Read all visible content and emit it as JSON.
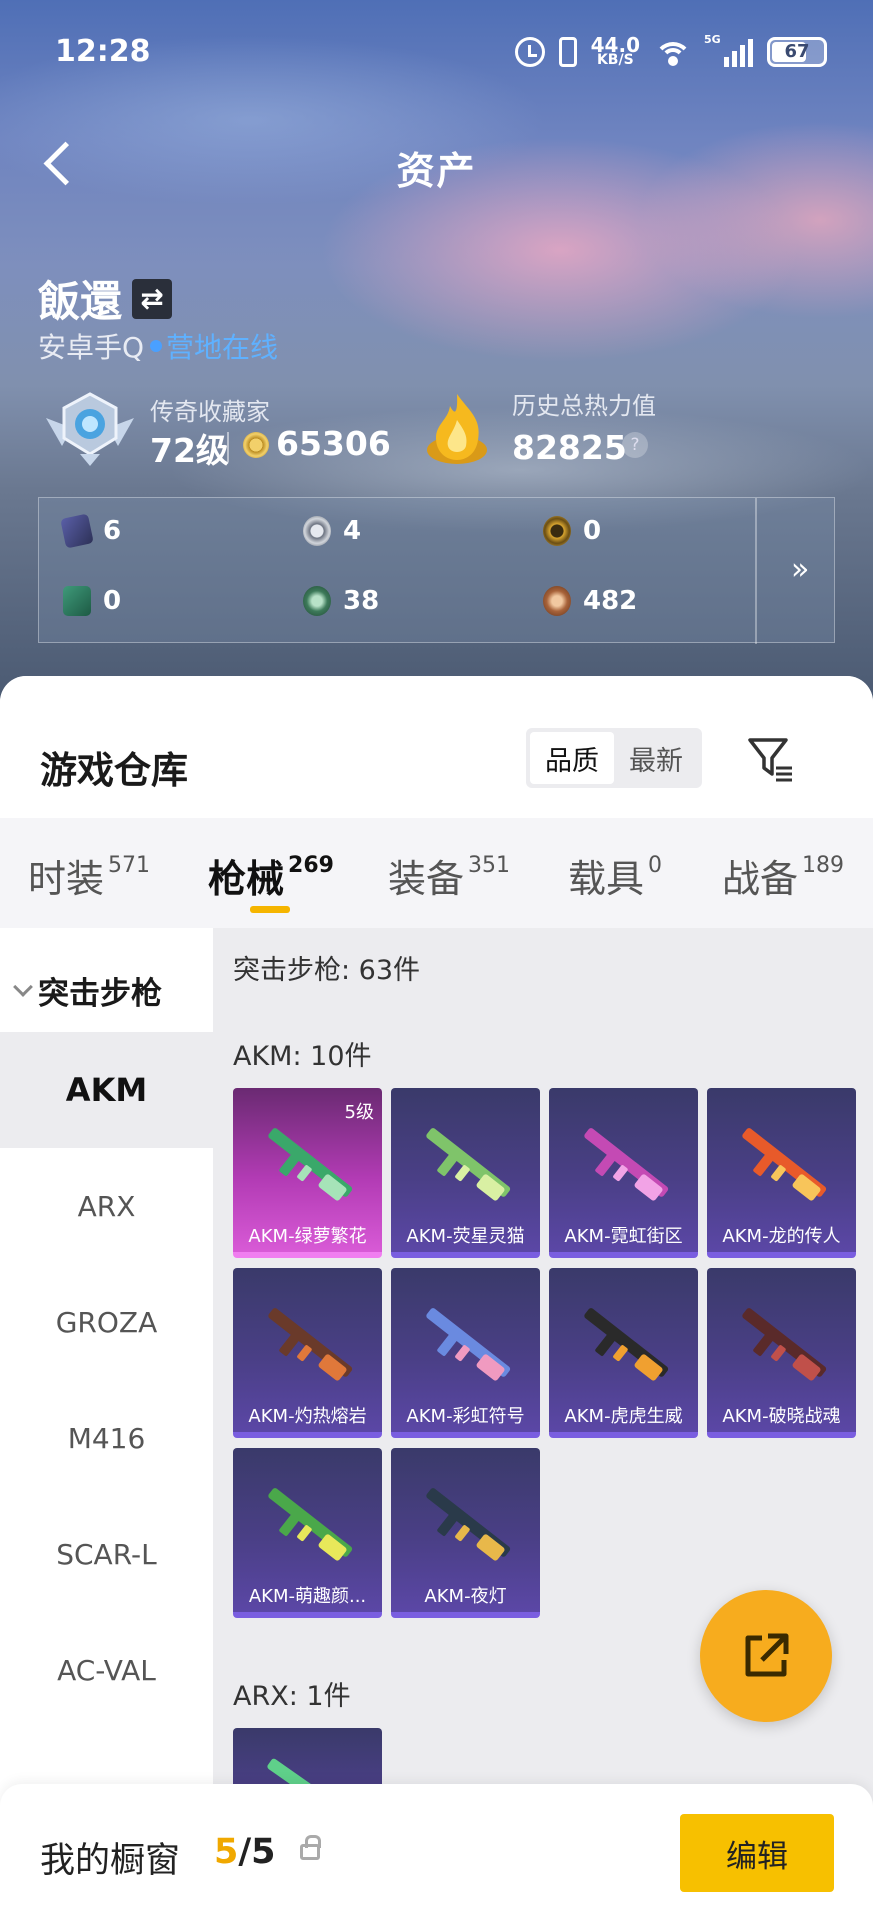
{
  "status_bar": {
    "time": "12:28",
    "net_speed_value": "44.0",
    "net_speed_unit": "KB/S",
    "network_type": "5G",
    "battery": "67"
  },
  "header": {
    "title": "资产"
  },
  "profile": {
    "name": "飯還",
    "platform": "安卓手Q",
    "presence": "营地在线",
    "rank_title": "传奇收藏家",
    "level": "72级",
    "coins": "65306",
    "heat_label": "历史总热力值",
    "heat_value": "82825",
    "help": "?"
  },
  "counts": [
    {
      "icon": "purple-card-icon",
      "value": "6"
    },
    {
      "icon": "silver-medal-icon",
      "value": "4"
    },
    {
      "icon": "gold-medal-icon",
      "value": "0"
    },
    {
      "icon": "green-card-icon",
      "value": "0"
    },
    {
      "icon": "green-coin-icon",
      "value": "38"
    },
    {
      "icon": "bronze-coin-icon",
      "value": "482"
    }
  ],
  "warehouse": {
    "title": "游戏仓库",
    "sort_options": [
      "品质",
      "最新"
    ],
    "tabs": [
      {
        "label": "时装",
        "count": "571"
      },
      {
        "label": "枪械",
        "count": "269"
      },
      {
        "label": "装备",
        "count": "351"
      },
      {
        "label": "载具",
        "count": "0"
      },
      {
        "label": "战备",
        "count": "189"
      }
    ],
    "category": "突击步枪",
    "sidebar_items": [
      "AKM",
      "ARX",
      "GROZA",
      "M416",
      "SCAR-L",
      "AC-VAL"
    ],
    "section_total": "突击步枪: 63件",
    "groups": [
      {
        "title": "AKM: 10件",
        "items": [
          {
            "name": "AKM-绿萝繁花",
            "level": "5级",
            "quality": "pink"
          },
          {
            "name": "AKM-荧星灵猫",
            "level": "",
            "quality": "purple"
          },
          {
            "name": "AKM-霓虹街区",
            "level": "",
            "quality": "purple"
          },
          {
            "name": "AKM-龙的传人",
            "level": "",
            "quality": "purple"
          },
          {
            "name": "AKM-灼热熔岩",
            "level": "",
            "quality": "purple"
          },
          {
            "name": "AKM-彩虹符号",
            "level": "",
            "quality": "purple"
          },
          {
            "name": "AKM-虎虎生威",
            "level": "",
            "quality": "purple"
          },
          {
            "name": "AKM-破晓战魂",
            "level": "",
            "quality": "purple"
          },
          {
            "name": "AKM-萌趣颜...",
            "level": "",
            "quality": "purple"
          },
          {
            "name": "AKM-夜灯",
            "level": "",
            "quality": "purple"
          }
        ]
      },
      {
        "title": "ARX: 1件",
        "items": []
      }
    ]
  },
  "bottom_bar": {
    "label": "我的橱窗",
    "current": "5",
    "separator": "/",
    "total": "5",
    "edit": "编辑"
  },
  "colors": {
    "accent": "#f7c000",
    "fab": "#f7ac1e",
    "online": "#5fb1ff",
    "pink_quality": "#d85ad6",
    "purple_quality": "#5b47a6"
  }
}
